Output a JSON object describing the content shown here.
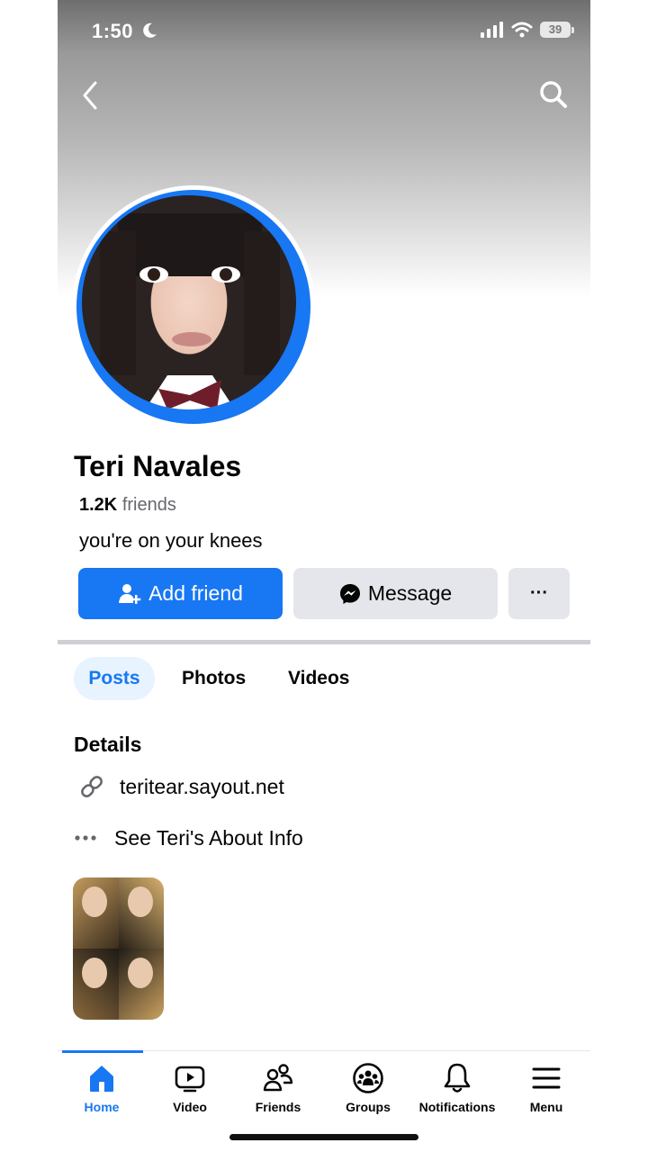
{
  "status_bar": {
    "time": "1:50",
    "battery": "39"
  },
  "profile": {
    "name": "Teri Navales",
    "friends_count": "1.2K",
    "friends_label": "friends",
    "bio": "you're on your knees"
  },
  "actions": {
    "add_friend": "Add friend",
    "message": "Message",
    "more": "···"
  },
  "tabs": [
    {
      "label": "Posts",
      "active": true
    },
    {
      "label": "Photos"
    },
    {
      "label": "Videos"
    }
  ],
  "details": {
    "title": "Details",
    "website": "teritear.sayout.net",
    "about": "See Teri's About Info"
  },
  "bottom_nav": [
    {
      "label": "Home",
      "icon": "home-icon",
      "active": true
    },
    {
      "label": "Video",
      "icon": "video-icon"
    },
    {
      "label": "Friends",
      "icon": "friends-icon"
    },
    {
      "label": "Groups",
      "icon": "groups-icon"
    },
    {
      "label": "Notifications",
      "icon": "bell-icon"
    },
    {
      "label": "Menu",
      "icon": "menu-icon"
    }
  ],
  "colors": {
    "accent": "#1877f2",
    "button_gray": "#e4e6eb",
    "tab_active_bg": "#e7f3ff"
  }
}
